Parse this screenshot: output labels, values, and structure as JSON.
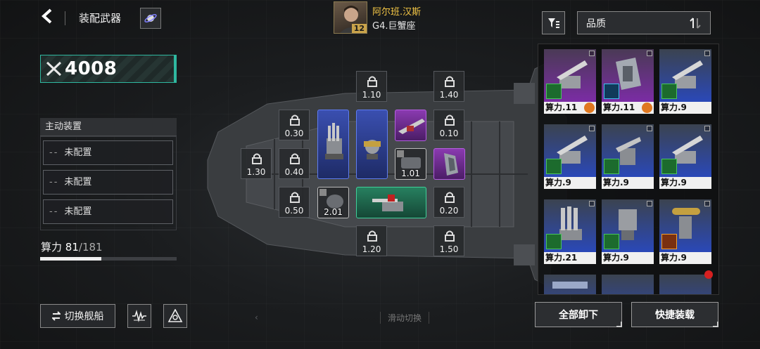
{
  "header": {
    "title": "装配武器",
    "captain": {
      "name": "阿尔班.汉斯",
      "ship": "G4.巨蟹座",
      "level": "12"
    }
  },
  "quality_select": {
    "value": "品质"
  },
  "power": {
    "value": "4008"
  },
  "active_devices": {
    "header": "主动装置",
    "slots": [
      {
        "dash": "--",
        "label": "未配置"
      },
      {
        "dash": "--",
        "label": "未配置"
      },
      {
        "dash": "--",
        "label": "未配置"
      }
    ]
  },
  "compute": {
    "label": "算力",
    "current": "81",
    "max": "/181",
    "fraction": 0.448
  },
  "bottom_left": {
    "switch_label": "切换舰船"
  },
  "swipe_hint": "滑动切换",
  "ship_slots": {
    "locked": [
      {
        "value": "1.10"
      },
      {
        "value": "1.40"
      },
      {
        "value": "0.30"
      },
      {
        "value": "0.10"
      },
      {
        "value": "1.30"
      },
      {
        "value": "0.40"
      },
      {
        "value": "0.50"
      },
      {
        "value": "0.20"
      },
      {
        "value": "1.20"
      },
      {
        "value": "1.50"
      }
    ],
    "equipped": [
      {
        "value": "1.01",
        "quality": "dark"
      },
      {
        "value": "2.01",
        "quality": "dark"
      }
    ]
  },
  "inventory": {
    "items": [
      {
        "label": "算力.11",
        "quality": "purple",
        "badge": "orange"
      },
      {
        "label": "算力.11",
        "quality": "purple",
        "badge": "orange"
      },
      {
        "label": "算力.9",
        "quality": "blue"
      },
      {
        "label": "算力.9",
        "quality": "blue"
      },
      {
        "label": "算力.9",
        "quality": "blue"
      },
      {
        "label": "算力.9",
        "quality": "blue"
      },
      {
        "label": "算力.21",
        "quality": "blue"
      },
      {
        "label": "算力.9",
        "quality": "blue"
      },
      {
        "label": "算力.9",
        "quality": "blue"
      }
    ]
  },
  "actions": {
    "unequip_all": "全部卸下",
    "quick_equip": "快捷装载"
  },
  "colors": {
    "accent_teal": "#2fb8a0",
    "captain_name": "#f2c545",
    "blue_quality": "#3a4fb0",
    "purple_quality": "#8a3ab0",
    "green_quality": "#27805f"
  }
}
